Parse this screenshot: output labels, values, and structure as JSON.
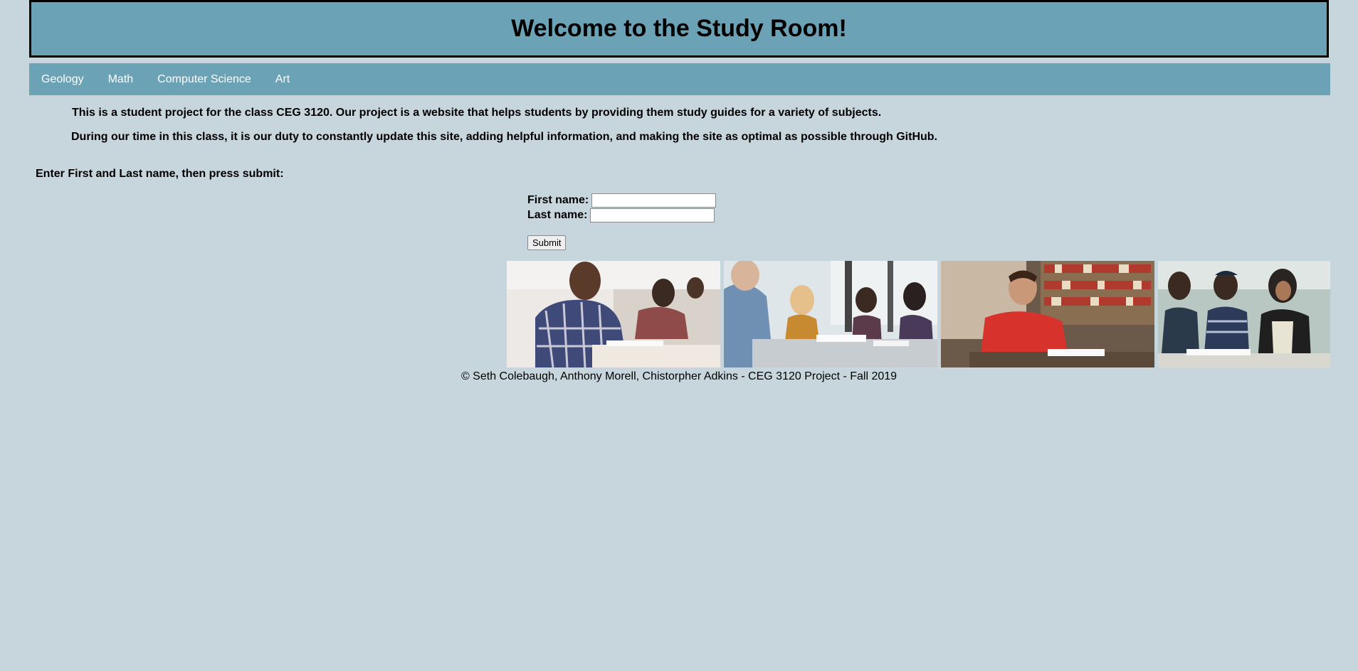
{
  "header": {
    "title": "Welcome to the Study Room!"
  },
  "nav": {
    "items": [
      {
        "label": "Geology"
      },
      {
        "label": "Math"
      },
      {
        "label": "Computer Science"
      },
      {
        "label": "Art"
      }
    ]
  },
  "intro": {
    "paragraph1": "This is a student project for the class CEG 3120. Our project is a website that helps students by providing them study guides for a variety of subjects.",
    "paragraph2": "During our time in this class, it is our duty to constantly update this site, adding helpful information, and making the site as optimal as possible through GitHub."
  },
  "form": {
    "prompt": "Enter First and Last name, then press submit:",
    "first_name_label": "First name:",
    "first_name_value": "",
    "last_name_label": "Last name:",
    "last_name_value": "",
    "submit_label": "Submit"
  },
  "footer": {
    "text": "© Seth Colebaugh, Anthony Morell, Chistorpher Adkins - CEG 3120 Project - Fall 2019"
  },
  "colors": {
    "background": "#c7d5dc",
    "banner": "#6ca2b5"
  }
}
